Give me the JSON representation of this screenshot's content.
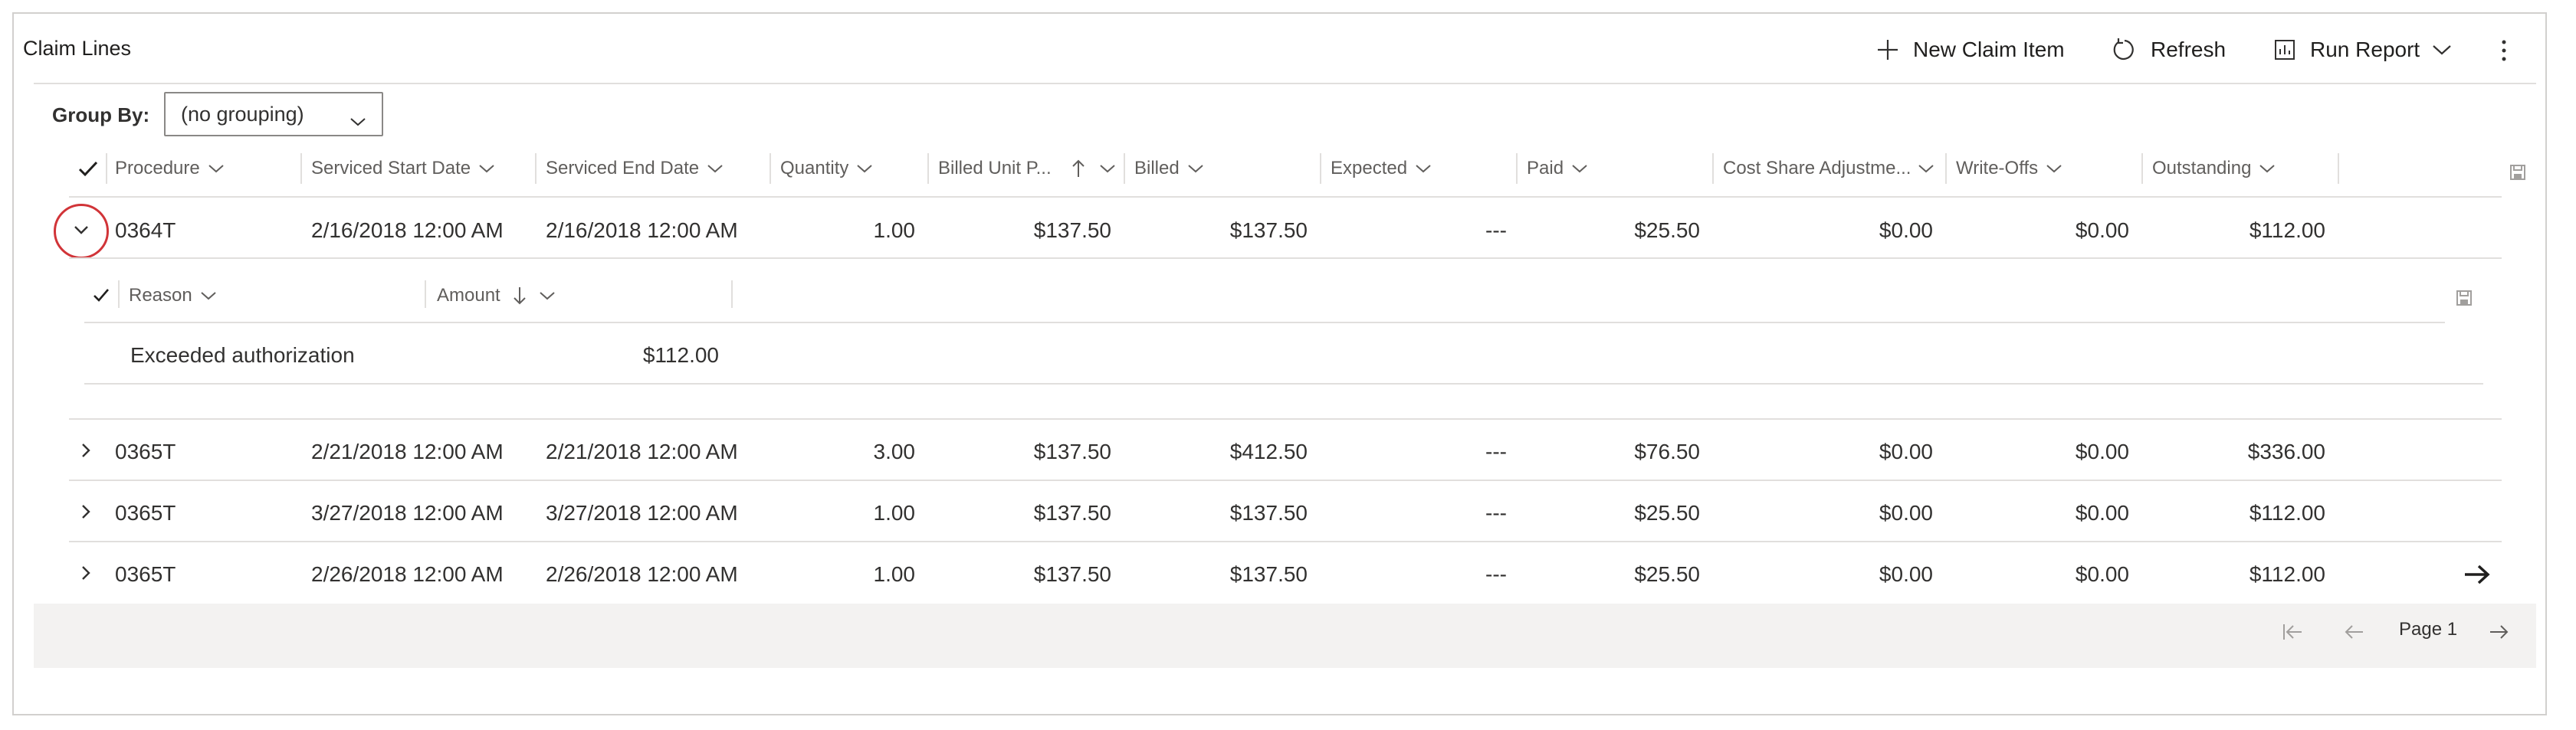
{
  "header": {
    "title": "Claim Lines",
    "commands": {
      "new_claim_item": "New Claim Item",
      "refresh": "Refresh",
      "run_report": "Run Report"
    }
  },
  "group_by": {
    "label": "Group By:",
    "value": "(no grouping)"
  },
  "columns": [
    "Procedure",
    "Serviced Start Date",
    "Serviced End Date",
    "Quantity",
    "Billed Unit P...",
    "Billed",
    "Expected",
    "Paid",
    "Cost Share Adjustme...",
    "Write-Offs",
    "Outstanding"
  ],
  "rows": [
    {
      "procedure": "0364T",
      "start": "2/16/2018 12:00 AM",
      "end": "2/16/2018 12:00 AM",
      "quantity": "1.00",
      "unit_price": "$137.50",
      "billed": "$137.50",
      "expected": "---",
      "paid": "$25.50",
      "cost_share": "$0.00",
      "write_offs": "$0.00",
      "outstanding": "$112.00"
    },
    {
      "procedure": "0365T",
      "start": "2/21/2018 12:00 AM",
      "end": "2/21/2018 12:00 AM",
      "quantity": "3.00",
      "unit_price": "$137.50",
      "billed": "$412.50",
      "expected": "---",
      "paid": "$76.50",
      "cost_share": "$0.00",
      "write_offs": "$0.00",
      "outstanding": "$336.00"
    },
    {
      "procedure": "0365T",
      "start": "3/27/2018 12:00 AM",
      "end": "3/27/2018 12:00 AM",
      "quantity": "1.00",
      "unit_price": "$137.50",
      "billed": "$137.50",
      "expected": "---",
      "paid": "$25.50",
      "cost_share": "$0.00",
      "write_offs": "$0.00",
      "outstanding": "$112.00"
    },
    {
      "procedure": "0365T",
      "start": "2/26/2018 12:00 AM",
      "end": "2/26/2018 12:00 AM",
      "quantity": "1.00",
      "unit_price": "$137.50",
      "billed": "$137.50",
      "expected": "---",
      "paid": "$25.50",
      "cost_share": "$0.00",
      "write_offs": "$0.00",
      "outstanding": "$112.00"
    }
  ],
  "subgrid": {
    "columns": [
      "Reason",
      "Amount"
    ],
    "rows": [
      {
        "reason": "Exceeded authorization",
        "amount": "$112.00"
      }
    ]
  },
  "footer": {
    "page_label": "Page 1"
  },
  "icons": {
    "add": "plus-icon",
    "refresh": "refresh-icon",
    "report": "report-icon",
    "more": "more-vertical-icon",
    "save": "save-icon",
    "expand": "chevron-right-icon",
    "collapse": "chevron-down-icon",
    "navigate": "arrow-right-icon"
  },
  "colors": {
    "highlight_circle": "#d13438",
    "footer_bg": "#f3f2f1"
  }
}
